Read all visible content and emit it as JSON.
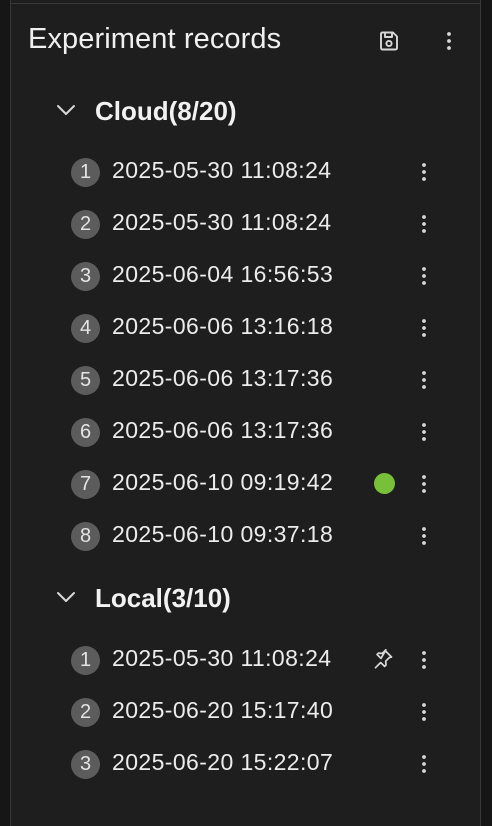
{
  "panel": {
    "title": "Experiment records",
    "save_icon": "save-icon",
    "more_icon": "more-vertical-icon"
  },
  "groups": [
    {
      "label": "Cloud(8/20)",
      "expanded": true,
      "records": [
        {
          "index": "1",
          "timestamp": "2025-05-30 11:08:24"
        },
        {
          "index": "2",
          "timestamp": "2025-05-30 11:08:24"
        },
        {
          "index": "3",
          "timestamp": "2025-06-04 16:56:53"
        },
        {
          "index": "4",
          "timestamp": "2025-06-06 13:16:18"
        },
        {
          "index": "5",
          "timestamp": "2025-06-06 13:17:36"
        },
        {
          "index": "6",
          "timestamp": "2025-06-06 13:17:36"
        },
        {
          "index": "7",
          "timestamp": "2025-06-10 09:19:42",
          "status_dot": "#78c03a"
        },
        {
          "index": "8",
          "timestamp": "2025-06-10 09:37:18"
        }
      ]
    },
    {
      "label": "Local(3/10)",
      "expanded": true,
      "records": [
        {
          "index": "1",
          "timestamp": "2025-05-30 11:08:24",
          "pinned": true
        },
        {
          "index": "2",
          "timestamp": "2025-06-20 15:17:40"
        },
        {
          "index": "3",
          "timestamp": "2025-06-20 15:22:07"
        }
      ]
    }
  ],
  "colors": {
    "background": "#1e1e1e",
    "badge": "#5c5c5c",
    "text": "#ececec",
    "status_green": "#78c03a"
  }
}
